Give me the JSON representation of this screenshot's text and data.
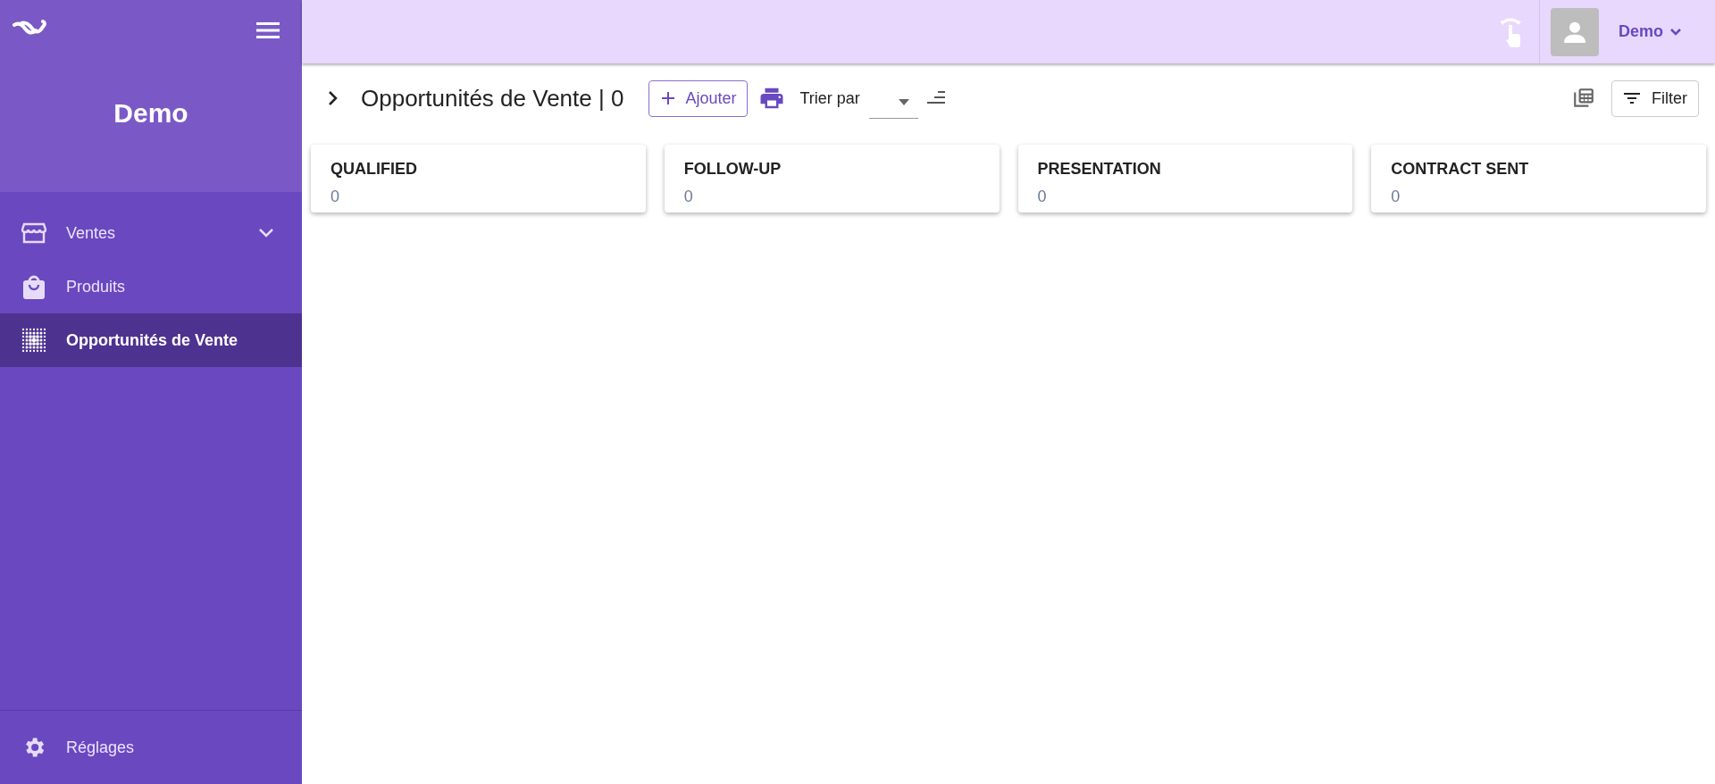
{
  "sidebar": {
    "title": "Demo",
    "items": [
      {
        "label": "Ventes",
        "expandable": true,
        "selected": false
      },
      {
        "label": "Produits",
        "expandable": false,
        "selected": false
      },
      {
        "label": "Opportunités de Vente",
        "expandable": false,
        "selected": true
      }
    ],
    "footer_item": {
      "label": "Réglages"
    }
  },
  "header": {
    "user": "Demo"
  },
  "toolbar": {
    "title": "Opportunités de Vente | 0",
    "add_button": "Ajouter",
    "sort_label": "Trier par",
    "filter_button": "Filter"
  },
  "columns": [
    {
      "title": "QUALIFIED",
      "count": "0"
    },
    {
      "title": "FOLLOW-UP",
      "count": "0"
    },
    {
      "title": "PRESENTATION",
      "count": "0"
    },
    {
      "title": "CONTRACT SENT",
      "count": "0"
    }
  ]
}
